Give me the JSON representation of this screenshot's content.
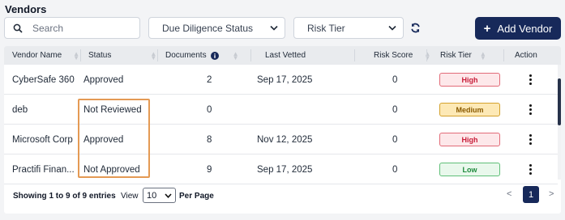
{
  "page": {
    "title": "Vendors"
  },
  "toolbar": {
    "search_placeholder": "Search",
    "due_diligence_label": "Due Diligence Status",
    "risk_tier_label": "Risk Tier",
    "add_vendor_label": "Add Vendor"
  },
  "table": {
    "headers": {
      "vendor_name": "Vendor Name",
      "status": "Status",
      "documents": "Documents",
      "last_vetted": "Last Vetted",
      "risk_score": "Risk Score",
      "risk_tier": "Risk Tier",
      "action": "Action"
    },
    "rows": [
      {
        "vendor": "CyberSafe 360",
        "status": "Approved",
        "documents": "2",
        "last_vetted": "Sep 17, 2025",
        "risk_score": "0",
        "risk_tier": "High"
      },
      {
        "vendor": "deb",
        "status": "Not Reviewed",
        "documents": "0",
        "last_vetted": "",
        "risk_score": "0",
        "risk_tier": "Medium"
      },
      {
        "vendor": "Microsoft Corp",
        "status": "Approved",
        "documents": "8",
        "last_vetted": "Nov 12, 2025",
        "risk_score": "0",
        "risk_tier": "High"
      },
      {
        "vendor": "Practifi Finan...",
        "status": "Not Approved",
        "documents": "9",
        "last_vetted": "Sep 17, 2025",
        "risk_score": "0",
        "risk_tier": "Low"
      }
    ]
  },
  "footer": {
    "entries_info": "Showing 1 to 9 of 9 entries",
    "view_label": "View",
    "per_page_value": "10",
    "per_page_label": "Per Page",
    "prev": "<",
    "current_page": "1",
    "next": ">"
  },
  "colors": {
    "primary": "#17295a",
    "highlight": "#e49a54"
  },
  "icons": {
    "search": "search-icon",
    "chevron": "chevron-down-icon",
    "refresh": "refresh-icon",
    "info": "info-icon",
    "sort": "sort-icon",
    "action": "kebab-menu-icon"
  }
}
